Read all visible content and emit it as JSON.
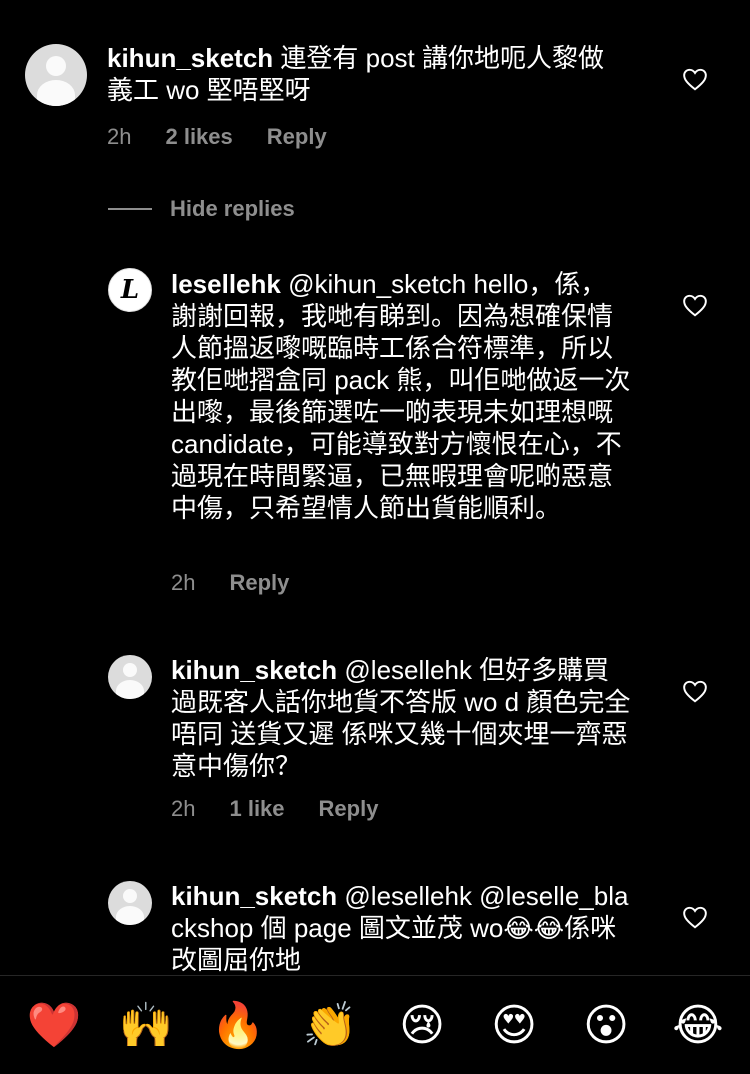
{
  "comments": [
    {
      "user": "kihun_sketch",
      "text": " 連登有 post 講你地呃人黎做義工 wo 堅唔堅呀",
      "time": "2h",
      "likes": "2 likes",
      "reply": "Reply"
    },
    {
      "user": "lesellehk",
      "text": " @kihun_sketch hello，係，謝謝回報，我哋有睇到。因為想確保情人節搵返嚟嘅臨時工係合符標準，所以教佢哋摺盒同 pack 熊，叫佢哋做返一次出嚟，最後篩選咗一啲表現未如理想嘅 candidate，可能導致對方懷恨在心，不過現在時間緊逼，已無暇理會呢啲惡意中傷，只希望情人節出貨能順利。",
      "time": "2h",
      "reply": "Reply",
      "avatar_letter": "L"
    },
    {
      "user": "kihun_sketch",
      "text": " @lesellehk 但好多購買過既客人話你地貨不答版 wo d 顏色完全唔同 送貨又遲 係咪又幾十個夾埋一齊惡意中傷你？",
      "time": "2h",
      "likes": "1 like",
      "reply": "Reply"
    },
    {
      "user": "kihun_sketch",
      "text": " @lesellehk @leselle_blackshop 個 page 圖文並茂 wo😂😂係咪改圖屈你地"
    }
  ],
  "hide_replies": "Hide replies",
  "emoji_bar": [
    "❤️",
    "🙌",
    "🔥",
    "👏",
    "😢",
    "😍",
    "😮",
    "😂"
  ],
  "colors": {
    "background": "#000000",
    "secondary_text": "#8e8e8e"
  }
}
